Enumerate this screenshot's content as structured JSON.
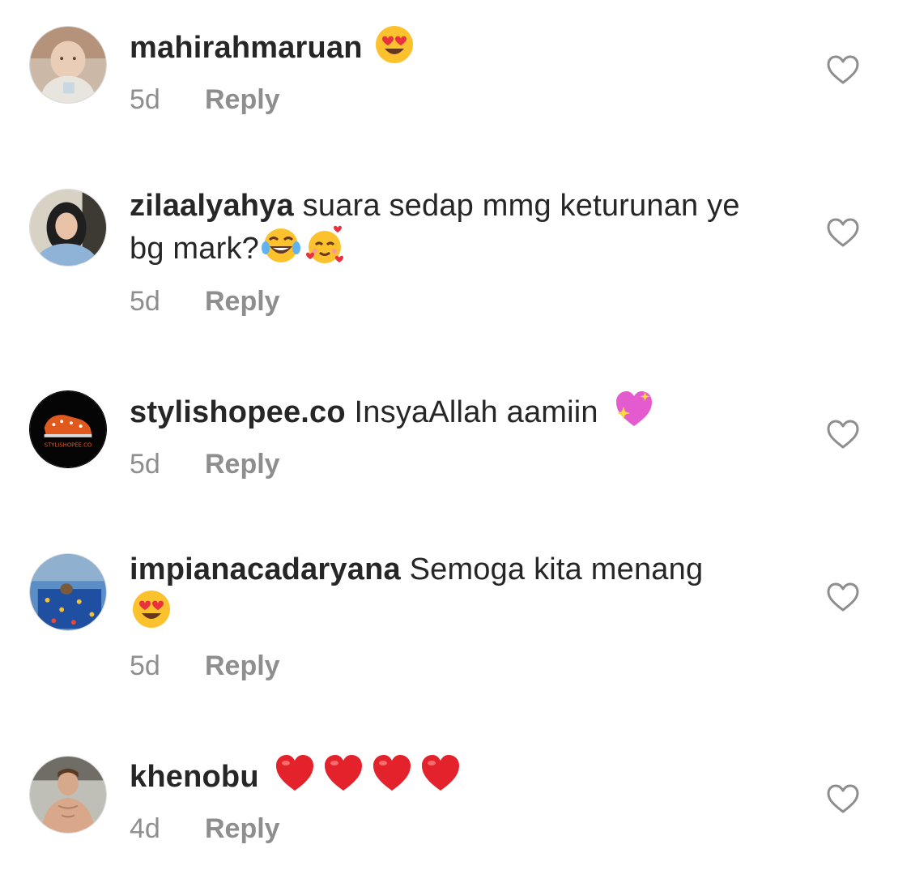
{
  "comments": [
    {
      "username": "mahirahmaruan",
      "text": "",
      "emojis": [
        "heart-eyes"
      ],
      "time": "5d",
      "reply": "Reply",
      "avatar": "baby-photo"
    },
    {
      "username": "zilaalyahya",
      "text": "suara sedap mmg keturunan ye bg mark?",
      "emojis": [
        "tears-of-joy",
        "smiling-with-hearts"
      ],
      "time": "5d",
      "reply": "Reply",
      "avatar": "woman-hijab-photo"
    },
    {
      "username": "stylishopee.co",
      "text": "InsyaAllah aamiin",
      "emojis": [
        "sparkling-heart"
      ],
      "time": "5d",
      "reply": "Reply",
      "avatar": "stylishopee-logo",
      "avatar_label": "STYLISHOPEE.CO"
    },
    {
      "username": "impianacadaryana",
      "text": "Semoga kita menang",
      "emojis": [
        "heart-eyes"
      ],
      "time": "5d",
      "reply": "Reply",
      "avatar": "bedsheet-photo"
    },
    {
      "username": "khenobu",
      "text": "",
      "emojis": [
        "red-heart",
        "red-heart",
        "red-heart",
        "red-heart"
      ],
      "time": "4d",
      "reply": "Reply",
      "avatar": "man-photo"
    }
  ],
  "colors": {
    "text": "#262626",
    "secondary": "#8e8e8e",
    "like_outline": "#8e8e8e"
  },
  "icons": {
    "like": "heart-outline-icon"
  }
}
